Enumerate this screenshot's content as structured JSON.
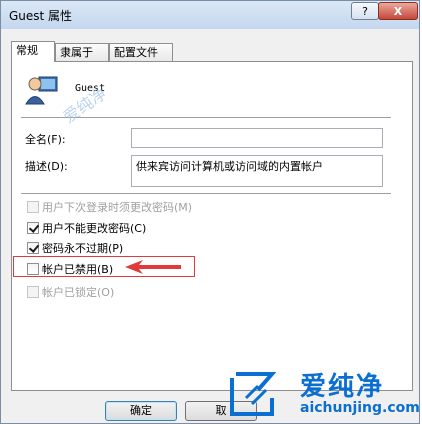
{
  "window": {
    "title": "Guest 属性",
    "help_label": "?",
    "close_label": "X"
  },
  "tabs": [
    {
      "label": "常规",
      "active": true
    },
    {
      "label": "隶属于",
      "active": false
    },
    {
      "label": "配置文件",
      "active": false
    }
  ],
  "user": {
    "name": "Guest"
  },
  "fields": {
    "fullname_label": "全名(F):",
    "fullname_value": "",
    "description_label": "描述(D):",
    "description_value": "供来宾访问计算机或访问域的内置帐户"
  },
  "options": [
    {
      "label": "用户下次登录时须更改密码(M)",
      "checked": false,
      "disabled": true
    },
    {
      "label": "用户不能更改密码(C)",
      "checked": true,
      "disabled": false
    },
    {
      "label": "密码永不过期(P)",
      "checked": true,
      "disabled": false
    },
    {
      "label": "帐户已禁用(B)",
      "checked": false,
      "disabled": false
    },
    {
      "label": "帐户已锁定(O)",
      "checked": false,
      "disabled": true
    }
  ],
  "buttons": {
    "ok": "确定",
    "cancel": "取"
  },
  "watermark": {
    "brand": "爱纯净",
    "url": "aichunjing.com",
    "faint": "爱纯净"
  },
  "colors": {
    "highlight": "#e03a3a",
    "watermark": "#0b6fd1"
  }
}
